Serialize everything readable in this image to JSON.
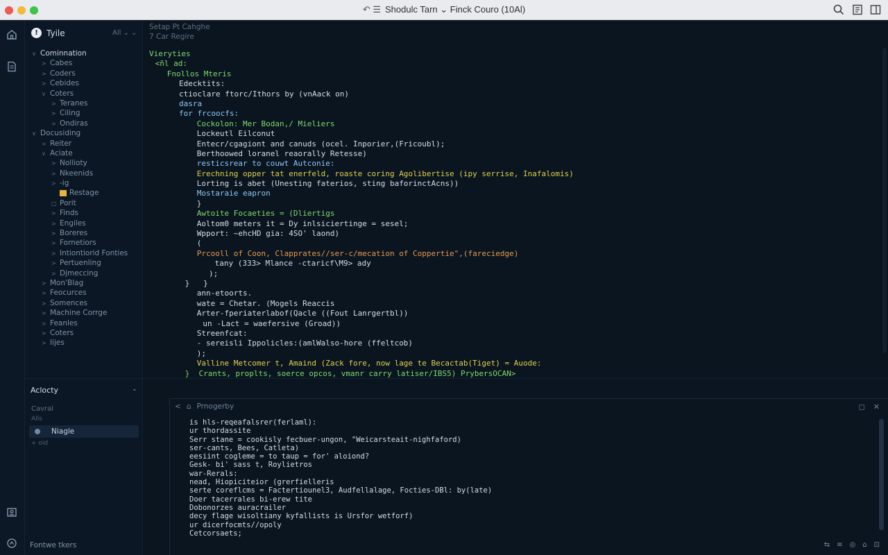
{
  "window": {
    "title": "Shodulc Tarn ⌄ Finck Couro (10Al)",
    "title_glyph": "↶ ☰"
  },
  "toolbar": {
    "search_icon": "search-icon",
    "book_icon": "book-icon",
    "panel_icon": "panel-icon"
  },
  "sidebar": {
    "badge": "!",
    "title": "Tyile",
    "filter": "All ⌄ ⌄",
    "items": [
      {
        "label": "Cominnation",
        "arrow": "∨",
        "indent": 0,
        "hl": true
      },
      {
        "label": "Cabes",
        "arrow": ">",
        "indent": 1
      },
      {
        "label": "Coders",
        "arrow": ">",
        "indent": 1
      },
      {
        "label": "Cebides",
        "arrow": ">",
        "indent": 1
      },
      {
        "label": "Coters",
        "arrow": "∨",
        "indent": 1
      },
      {
        "label": "Teranes",
        "arrow": ">",
        "indent": 2
      },
      {
        "label": "Ciling",
        "arrow": ">",
        "indent": 2
      },
      {
        "label": "Ondiras",
        "arrow": ">",
        "indent": 2
      },
      {
        "label": "Docusiding",
        "arrow": "∨",
        "indent": 0
      },
      {
        "label": "Reiter",
        "arrow": ">",
        "indent": 1
      },
      {
        "label": "Aciate",
        "arrow": "∨",
        "indent": 1
      },
      {
        "label": "Nollioty",
        "arrow": ">",
        "indent": 2
      },
      {
        "label": "Nkeenids",
        "arrow": ">",
        "indent": 2
      },
      {
        "label": "-ig",
        "arrow": ">",
        "indent": 2
      },
      {
        "label": "Restage",
        "arrow": "",
        "indent": 2,
        "glyph": "yellow"
      },
      {
        "label": "Porit",
        "arrow": "□",
        "indent": 2
      },
      {
        "label": "Finds",
        "arrow": ">",
        "indent": 2
      },
      {
        "label": "Engiles",
        "arrow": ">",
        "indent": 2
      },
      {
        "label": "Boreres",
        "arrow": ">",
        "indent": 2
      },
      {
        "label": "Fornetiors",
        "arrow": ">",
        "indent": 2
      },
      {
        "label": "Intiontiorid Fonties",
        "arrow": ">",
        "indent": 2
      },
      {
        "label": "Pertuenling",
        "arrow": ">",
        "indent": 2
      },
      {
        "label": "Djmeccing",
        "arrow": ">",
        "indent": 2
      },
      {
        "label": "Mon'Blag",
        "arrow": ">",
        "indent": 1
      },
      {
        "label": "Feocurces",
        "arrow": ">",
        "indent": 1
      },
      {
        "label": "Somences",
        "arrow": ">",
        "indent": 1
      },
      {
        "label": "Machine Corrge",
        "arrow": ">",
        "indent": 1
      },
      {
        "label": "Feanles",
        "arrow": ">",
        "indent": 1
      },
      {
        "label": "Coters",
        "arrow": ">",
        "indent": 1
      },
      {
        "label": "Iijes",
        "arrow": ">",
        "indent": 1
      }
    ]
  },
  "editor": {
    "breadcrumb_1": "Setap Pt Cahghe",
    "breadcrumb_2": "7 Car Regire",
    "lines": [
      {
        "indent": 0,
        "c": "g",
        "t": "Vieryties"
      },
      {
        "indent": 1,
        "c": "g",
        "t": "<ñl ad:"
      },
      {
        "indent": 3,
        "c": "g",
        "t": "Fnollos Mteris"
      },
      {
        "indent": 5,
        "c": "w",
        "t": "Edecktits:"
      },
      {
        "indent": 5,
        "c": "w",
        "t": "ctioclare ftorc/Ithors by (vnAack on)"
      },
      {
        "indent": 5,
        "c": "b",
        "t": "dasra"
      },
      {
        "indent": 5,
        "c": "b",
        "t": "for frcoocfs:"
      },
      {
        "indent": 8,
        "c": "g",
        "t": "Cockolon: Mer Bodan,/ Mieliers"
      },
      {
        "indent": 8,
        "c": "w",
        "t": "Lockeutl Eilconut"
      },
      {
        "indent": 8,
        "c": "w",
        "t": "Entecr/cgagiont and canuds (ocel. Inporier,(Fricoubl);"
      },
      {
        "indent": 8,
        "c": "w",
        "t": "Berthoowed loranel reaorally Retesse)"
      },
      {
        "indent": 8,
        "c": "b",
        "t": "resticsrear to couwt Autconie:"
      },
      {
        "indent": 8,
        "c": "y",
        "t": "Erechning opper tat enerfeld, roaste coring Agolibertise (ipy serrise, Inafalomis)"
      },
      {
        "indent": 8,
        "c": "w",
        "t": "Lorting is abet (Unesting faterios, sting baforinctAcns))"
      },
      {
        "indent": 8,
        "c": "b",
        "t": "Mostaraie eapron"
      },
      {
        "indent": 8,
        "c": "w",
        "t": "}"
      },
      {
        "indent": 8,
        "c": "g",
        "t": "Awtoite Focaeties = (Dliertigs"
      },
      {
        "indent": 8,
        "c": "w",
        "t": "Aoltom0 meters it = Dy inlsiciertinge = sesel;"
      },
      {
        "indent": 8,
        "c": "w",
        "t": "Wpport: ~ehcHD gia: 4SO' laond)"
      },
      {
        "indent": 8,
        "c": "w",
        "t": "("
      },
      {
        "indent": 8,
        "c": "o",
        "t": "Prcooll of Coon, Clapprates//ser-c/mecation of Coppertie\",(fareciedge)"
      },
      {
        "indent": 11,
        "c": "w",
        "t": "tany (333> Mlance -ctaricf\\M9> ady"
      },
      {
        "indent": 10,
        "c": "w",
        "t": ");"
      },
      {
        "indent": 6,
        "c": "w",
        "t": "}   }"
      },
      {
        "indent": 8,
        "c": "w",
        "t": "ann-etoorts."
      },
      {
        "indent": 8,
        "c": "w",
        "t": "wate = Chetar. (Mogels Reaccis"
      },
      {
        "indent": 8,
        "c": "w",
        "t": "Arter-fperiaterlabof(Qacle ((Fout Lanrgertbl))"
      },
      {
        "indent": 9,
        "c": "w",
        "t": "un -Lact = waefersive (Groad))"
      },
      {
        "indent": 8,
        "c": "w",
        "t": "Streenfcat:"
      },
      {
        "indent": 8,
        "c": "w",
        "t": "- sereisli Ippolicles:(amlWalso-hore (ffeltcob)"
      },
      {
        "indent": 8,
        "c": "w",
        "t": ");"
      },
      {
        "indent": 8,
        "c": "y",
        "t": "Valline Metcomer t, Amaind (Zack fore, now lage te Becactab(Tiget) = Auode:"
      },
      {
        "indent": 6,
        "c": "g",
        "t": "}  Crants, proplts, soerce opcos, vmanr carry latiser/IBS5) PrybersOCAN>"
      }
    ]
  },
  "bottom_left": {
    "title": "Aclocty",
    "chevron": "⌄",
    "category": "Cavral",
    "sub1": "Alls",
    "item": "Niagle",
    "sub2": "+ oid",
    "footer": "Fontwe tkers"
  },
  "terminal": {
    "header": "Prnogerby",
    "nav_back": "<",
    "nav_home": "⌂",
    "tool_1": "◻",
    "tool_2": "✕",
    "lines": [
      "is hls-reqeafalsrer(ferlaml):",
      "ur thordassite",
      "Serr stane = cookisly fecbuer-ungon, \"Weicarsteait-nighfaford)",
      "ser-cants, Bees, Catleta)",
      "eesiint cogleme = to taup = for' aloiond?",
      "Gesk- bi' sass t, Roylietros",
      "war-Rerals:",
      "nead, Hiopiciteior (grerfielleris",
      "serte coreflcms = Factertiounel3, Audfellalage, Focties-DBl: by(late)",
      "Doer tacerrales bi-erew tite",
      "Dobonorzes auracrailer",
      "decy flage wisoltiany kyfallists is Ursfor wetforf)",
      "ur dicerfocmts//opoly",
      "Cetcorsaets;"
    ]
  },
  "status": {
    "icons": [
      "⇆",
      "≡",
      "◎",
      "⌂",
      "⊡"
    ]
  }
}
